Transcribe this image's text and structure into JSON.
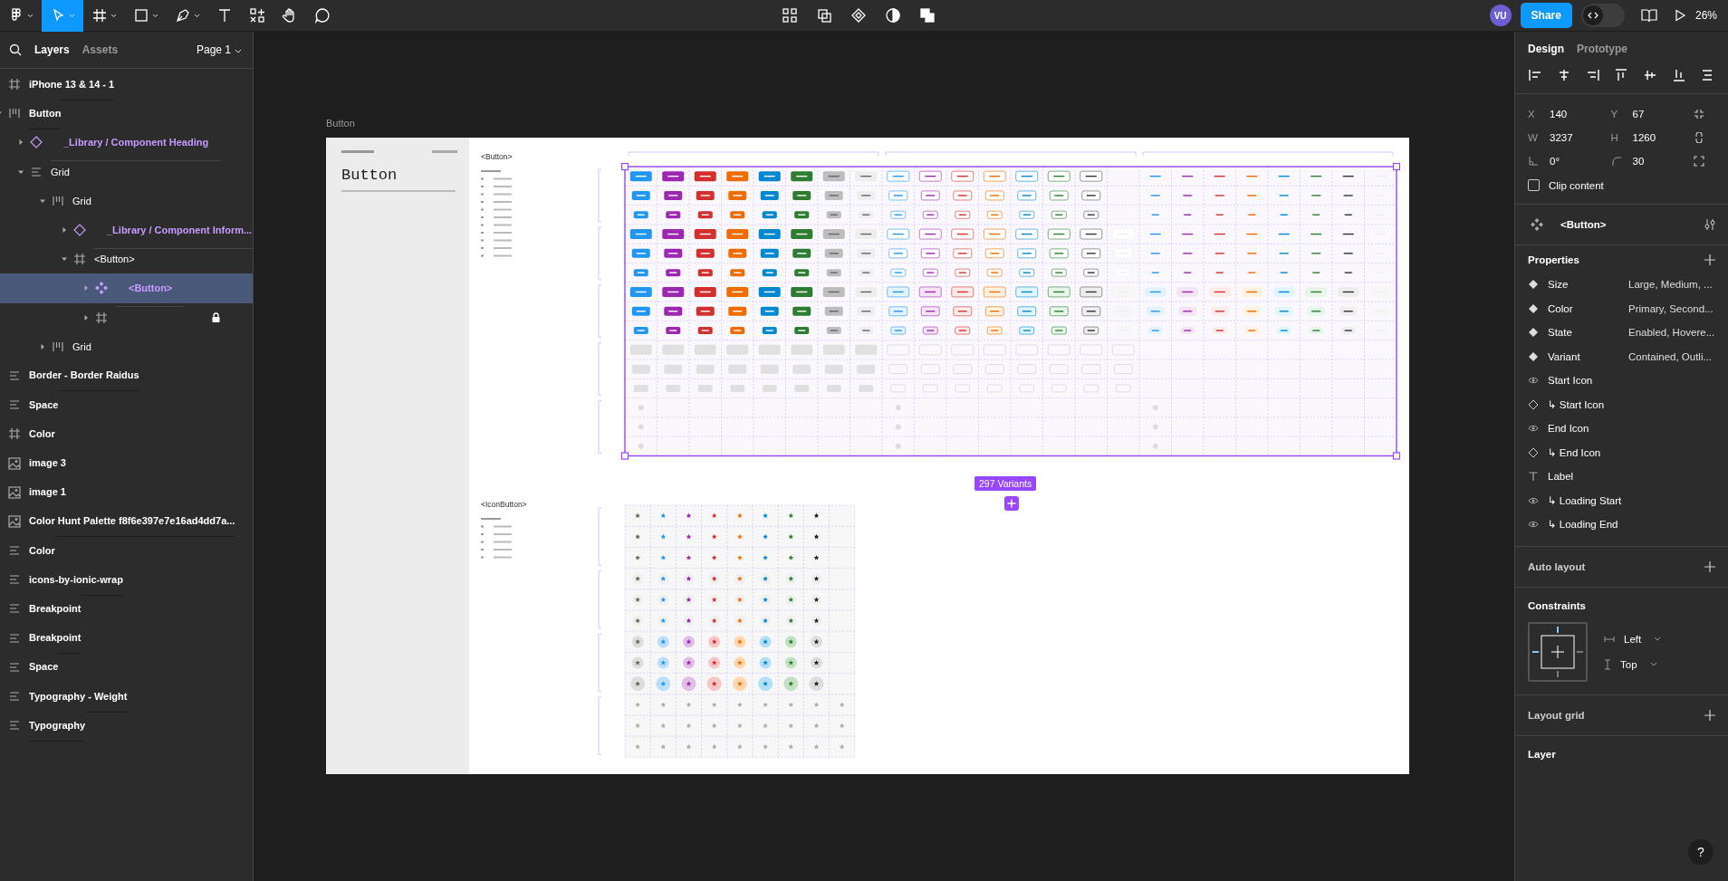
{
  "toolbar": {
    "left_tools": [
      {
        "kind": "logo",
        "selected": false,
        "has_menu": true
      },
      {
        "kind": "move",
        "selected": true,
        "has_menu": true
      },
      {
        "kind": "frame",
        "selected": false,
        "has_menu": true
      },
      {
        "kind": "shape",
        "selected": false,
        "has_menu": true
      },
      {
        "kind": "pen",
        "selected": false,
        "has_menu": true
      },
      {
        "kind": "text",
        "selected": false,
        "has_menu": false
      },
      {
        "kind": "resources",
        "selected": false,
        "has_menu": false
      },
      {
        "kind": "hand",
        "selected": false,
        "has_menu": false
      },
      {
        "kind": "comment",
        "selected": false,
        "has_menu": false
      }
    ],
    "center_tools": [
      {
        "kind": "grid"
      },
      {
        "kind": "crop"
      },
      {
        "kind": "component"
      },
      {
        "kind": "contrast"
      },
      {
        "kind": "boolean"
      }
    ],
    "avatar": "VU",
    "share": "Share",
    "dev_mode": {
      "on": false
    },
    "zoom": "26%"
  },
  "layers_panel": {
    "tabs": [
      {
        "label": "Layers",
        "selected": true
      },
      {
        "label": "Assets",
        "selected": false
      }
    ],
    "page": "Page 1",
    "layers": [
      {
        "name": "iPhone 13 & 14 - 1",
        "kind": "frame"
      },
      {
        "name": "Button",
        "kind": "autolayout",
        "expanded": true,
        "children": [
          {
            "name": "_Library / Component Heading",
            "kind": "instance",
            "component": true,
            "expanded": false
          },
          {
            "name": "Grid",
            "kind": "stack",
            "expanded": true,
            "children": [
              {
                "name": "Grid",
                "kind": "autolayout",
                "expanded": true,
                "children": [
                  {
                    "name": "_Library / Component Inform...",
                    "kind": "instance",
                    "component": true,
                    "expanded": false
                  },
                  {
                    "name": "<Button>",
                    "kind": "frame",
                    "expanded": true,
                    "children": [
                      {
                        "name": "<Button>",
                        "kind": "component-set",
                        "component": true,
                        "selected": true,
                        "expanded": false
                      },
                      {
                        "kind": "frame",
                        "locked": true,
                        "expanded": false
                      }
                    ]
                  }
                ]
              },
              {
                "name": "Grid",
                "kind": "autolayout",
                "expanded": false
              }
            ]
          }
        ]
      },
      {
        "name": "Border - Border Raidus",
        "kind": "stack"
      },
      {
        "name": "Space",
        "kind": "stack"
      },
      {
        "name": "Color",
        "kind": "frame"
      },
      {
        "name": "image 3",
        "kind": "image"
      },
      {
        "name": "image 1",
        "kind": "image"
      },
      {
        "name": "Color Hunt Palette f8f6e397e7e16ad4dd7a...",
        "kind": "image"
      },
      {
        "name": "Color",
        "kind": "stack"
      },
      {
        "name": "icons-by-ionic-wrap",
        "kind": "stack"
      },
      {
        "name": "Breakpoint",
        "kind": "stack"
      },
      {
        "name": "Breakpoint",
        "kind": "stack"
      },
      {
        "name": "Space",
        "kind": "stack"
      },
      {
        "name": "Typography - Weight",
        "kind": "stack"
      },
      {
        "name": "Typography",
        "kind": "stack"
      }
    ]
  },
  "canvas": {
    "frame_label": "Button",
    "heading": "Button",
    "button_title": "<Button>",
    "icon_button_title": "<IconButton>",
    "variants_badge": "297 Variants"
  },
  "design_panel": {
    "tabs": [
      {
        "label": "Design",
        "selected": true
      },
      {
        "label": "Prototype",
        "selected": false
      }
    ],
    "fields": [
      {
        "kind": "x",
        "label": "X",
        "value": "140"
      },
      {
        "kind": "y",
        "label": "Y",
        "value": "67"
      },
      {
        "kind": "w",
        "label": "W",
        "value": "3237"
      },
      {
        "kind": "h",
        "label": "H",
        "value": "1260"
      },
      {
        "kind": "rotation",
        "value": "0°"
      },
      {
        "kind": "radius",
        "value": "30"
      }
    ],
    "clip_content": {
      "label": "Clip content",
      "checked": false
    },
    "component": "<Button>",
    "properties_title": "Properties",
    "properties": [
      {
        "kind": "variant",
        "name": "Size",
        "value": "Large, Medium, ..."
      },
      {
        "kind": "variant",
        "name": "Color",
        "value": "Primary, Second..."
      },
      {
        "kind": "variant",
        "name": "State",
        "value": "Enabled, Hovere..."
      },
      {
        "kind": "variant",
        "name": "Variant",
        "value": "Contained, Outli..."
      },
      {
        "kind": "boolean",
        "name": "Start Icon"
      },
      {
        "kind": "swap",
        "name": "↳ Start Icon"
      },
      {
        "kind": "boolean",
        "name": "End Icon"
      },
      {
        "kind": "swap",
        "name": "↳ End Icon"
      },
      {
        "kind": "text",
        "name": "Label"
      },
      {
        "kind": "boolean",
        "name": "↳ Loading Start"
      },
      {
        "kind": "boolean",
        "name": "↳ Loading End"
      }
    ],
    "auto_layout": "Auto layout",
    "constraints": {
      "title": "Constraints",
      "horizontal": "Left",
      "vertical": "Top"
    },
    "layout_grid": "Layout grid",
    "layer": "Layer",
    "help": "?"
  }
}
